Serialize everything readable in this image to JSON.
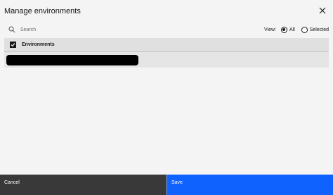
{
  "modal": {
    "title": "Manage environments"
  },
  "search": {
    "placeholder": "Search"
  },
  "view_filter": {
    "label": "View:",
    "options": [
      {
        "label": "All",
        "selected": true
      },
      {
        "label": "Selected",
        "selected": false
      }
    ]
  },
  "table": {
    "header_label": "Environments",
    "select_all_checked": true,
    "rows": [
      {
        "label": "",
        "redacted": true
      }
    ]
  },
  "footer": {
    "cancel_label": "Cancel",
    "save_label": "Save"
  },
  "colors": {
    "primary": "#0f62fe",
    "secondary": "#393939",
    "background": "#f4f4f4"
  },
  "icons": {
    "close": "close-icon",
    "search": "search-icon",
    "checkbox": "checkmark-icon"
  }
}
